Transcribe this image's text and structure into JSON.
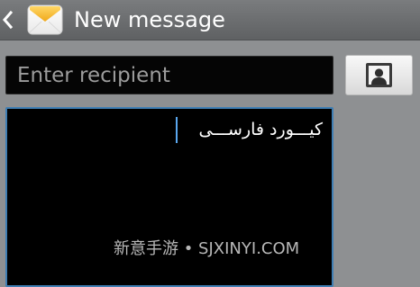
{
  "action_bar": {
    "title": "New message",
    "back_icon": "chevron-left-icon",
    "app_icon": "envelope-icon"
  },
  "recipient": {
    "placeholder": "Enter recipient",
    "value": "",
    "contacts_icon": "contact-card-icon"
  },
  "message": {
    "text": "کیـــورد فارســـی"
  },
  "watermark": "新意手游 • SJXINYI.COM",
  "colors": {
    "action_bar": "#6b6d6f",
    "background": "#8e9092",
    "input_background": "#050505",
    "focus_border": "#3f7eb3",
    "cursor": "#5aa7ef"
  }
}
